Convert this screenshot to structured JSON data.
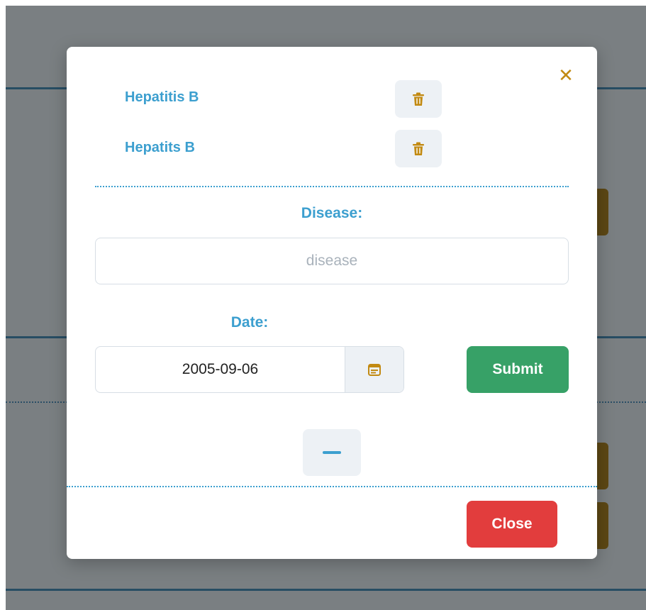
{
  "modal": {
    "close_icon": "close-icon",
    "records": [
      {
        "name": "Hepatitis B",
        "delete_icon": "trash-icon"
      },
      {
        "name": "Hepatits B",
        "delete_icon": "trash-icon"
      }
    ],
    "disease_label": "Disease:",
    "disease_placeholder": "disease",
    "disease_value": "",
    "date_label": "Date:",
    "date_value": "2005-09-06",
    "calendar_icon": "calendar-icon",
    "submit_label": "Submit",
    "remove_icon": "minus-icon",
    "close_label": "Close"
  },
  "colors": {
    "accent_blue": "#3c9fcf",
    "icon_gold": "#c28a12",
    "submit_green": "#37a167",
    "close_red": "#e23d3d",
    "overlay_gray": "#7a7f82"
  }
}
